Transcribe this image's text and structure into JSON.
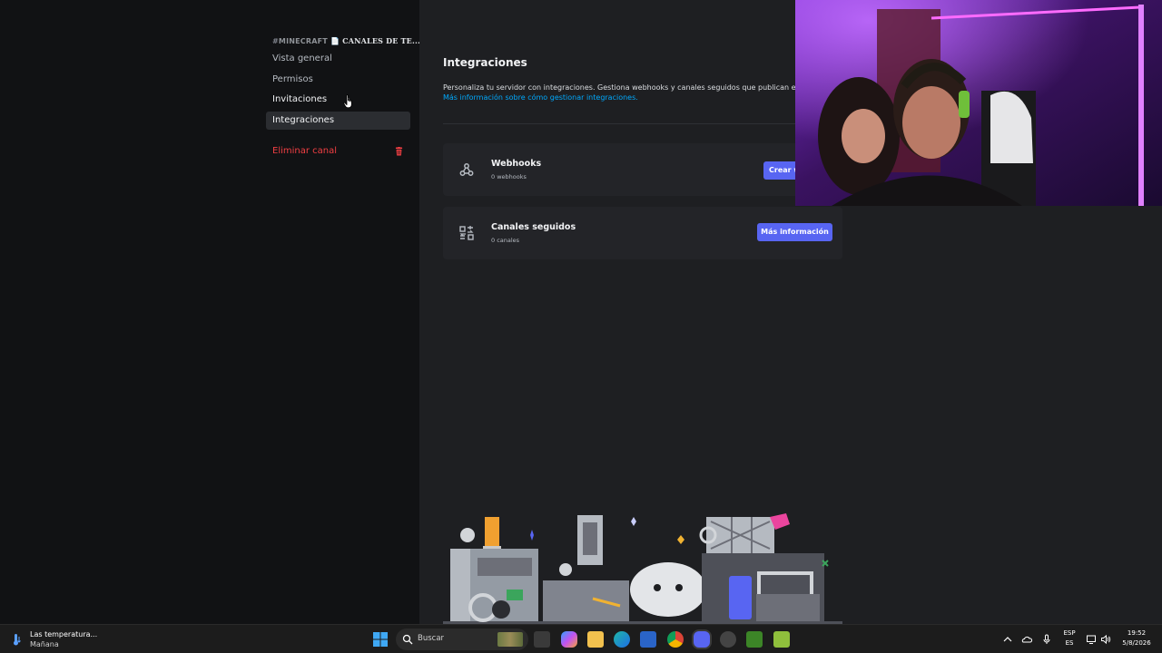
{
  "sidebar": {
    "channel_category": "MINECRAFT",
    "channel_name": "CANALES DE TE...",
    "items": [
      {
        "label": "Vista general"
      },
      {
        "label": "Permisos"
      },
      {
        "label": "Invitaciones"
      },
      {
        "label": "Integraciones"
      }
    ],
    "delete_label": "Eliminar canal"
  },
  "main": {
    "title": "Integraciones",
    "description": "Personaliza tu servidor con integraciones. Gestiona webhooks y canales seguidos que publican en e",
    "link": "Más información sobre cómo gestionar integraciones.",
    "cards": [
      {
        "title": "Webhooks",
        "subtitle": "0 webhooks",
        "button": "Crear webhook",
        "icon": "webhook-icon"
      },
      {
        "title": "Canales seguidos",
        "subtitle": "0 canales",
        "button": "Más información",
        "icon": "followed-channels-icon"
      }
    ]
  },
  "taskbar": {
    "weather_title": "Las temperatura...",
    "weather_sub": "Mañana",
    "search_placeholder": "Buscar",
    "lang_top": "ESP",
    "lang_bottom": "ES",
    "time": "19:52",
    "date": "5/8/2026"
  },
  "colors": {
    "accent": "#5865f2",
    "danger": "#f23f43",
    "link": "#00a8fc",
    "background": "#1e1f22",
    "sidebar": "#111214"
  }
}
